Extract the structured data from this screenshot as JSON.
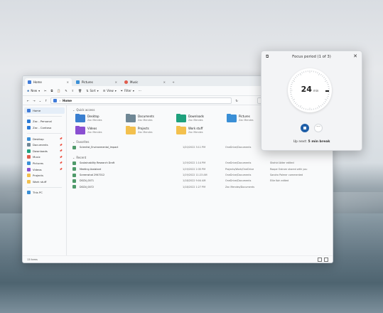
{
  "explorer": {
    "tabs": [
      {
        "label": "Home",
        "icon": "home-icon",
        "active": true
      },
      {
        "label": "Pictures",
        "icon": "pictures-folder-icon",
        "active": false
      },
      {
        "label": "Music",
        "icon": "music-icon",
        "active": false
      }
    ],
    "toolbar": {
      "new": "New",
      "sort": "Sort",
      "view": "View",
      "filter": "Filter"
    },
    "address": "Home",
    "nav": [
      {
        "label": "Home",
        "selected": true,
        "pinned": false,
        "color": "#3f7bd9"
      },
      {
        "label": "Zac - Personal",
        "selected": false,
        "pinned": false,
        "color": "#2a79d6"
      },
      {
        "label": "Zac - Contoso",
        "selected": false,
        "pinned": false,
        "color": "#2a79d6"
      },
      {
        "label": "Desktop",
        "selected": false,
        "pinned": true,
        "color": "#3a8fd6"
      },
      {
        "label": "Documents",
        "selected": false,
        "pinned": true,
        "color": "#6f8795"
      },
      {
        "label": "Downloads",
        "selected": false,
        "pinned": true,
        "color": "#1fa17d"
      },
      {
        "label": "Music",
        "selected": false,
        "pinned": true,
        "color": "#e05c4d"
      },
      {
        "label": "Pictures",
        "selected": false,
        "pinned": true,
        "color": "#3a8fd6"
      },
      {
        "label": "Videos",
        "selected": false,
        "pinned": true,
        "color": "#8a4fd1"
      },
      {
        "label": "Projects",
        "selected": false,
        "pinned": false,
        "color": "#f3c04d"
      },
      {
        "label": "Work stuff",
        "selected": false,
        "pinned": false,
        "color": "#f3c04d"
      },
      {
        "label": "This PC",
        "selected": false,
        "pinned": false,
        "color": "#3a8fd6"
      }
    ],
    "quick_access_label": "Quick access",
    "quick_access": [
      {
        "name": "Desktop",
        "sub": "Zac Mendes",
        "color": "#3a7fd0"
      },
      {
        "name": "Documents",
        "sub": "Zac Mendes",
        "color": "#6f8795"
      },
      {
        "name": "Downloads",
        "sub": "Zac Mendes",
        "color": "#1fa17d"
      },
      {
        "name": "Pictures",
        "sub": "Zac Mendes",
        "color": "#3a8fd6"
      },
      {
        "name": "Videos",
        "sub": "Zac Mendes",
        "color": "#8a4fd1"
      },
      {
        "name": "Projects",
        "sub": "Zac Mendes",
        "color": "#f3c04d"
      },
      {
        "name": "Work stuff",
        "sub": "Zac Mendes",
        "color": "#f3c04d"
      }
    ],
    "favorites_label": "Favorites",
    "favorites": [
      {
        "name": "Scientist_Environmental_Impact",
        "date": "1/20/2022 3:11 PM",
        "location": "OneDrive/Documents",
        "activity": "coordinate edit a comment"
      }
    ],
    "recent_label": "Recent",
    "recent": [
      {
        "name": "Sustainability Research Draft",
        "date": "1/19/2022 1:14 PM",
        "location": "OneDrive/Documents",
        "activity": "Shahid Akter edited"
      },
      {
        "name": "Meeting Assistant",
        "date": "1/19/2022 2:35 PM",
        "location": "Projects/Work/OneDrive",
        "activity": "Roope Ostrom shared with you"
      },
      {
        "name": "Screenshot 2947012",
        "date": "1/19/2022 11:23 AM",
        "location": "OneDrive/Documents",
        "activity": "Sandra Palmer commented"
      },
      {
        "name": "DSCN_0071",
        "date": "1/18/2022 9:04 AM",
        "location": "OneDrive/Documents",
        "activity": "Ellie Koh edited"
      },
      {
        "name": "DSCN_0072",
        "date": "1/18/2022 1:27 PM",
        "location": "Zac Mendes/Documents",
        "activity": ""
      }
    ],
    "status": "13 items"
  },
  "focus": {
    "title": "Focus period (1 of 3)",
    "minutes": "24",
    "unit": "min",
    "next_prefix": "Up next:",
    "next_value": "5 min break",
    "accent": "#1f5fa8"
  }
}
